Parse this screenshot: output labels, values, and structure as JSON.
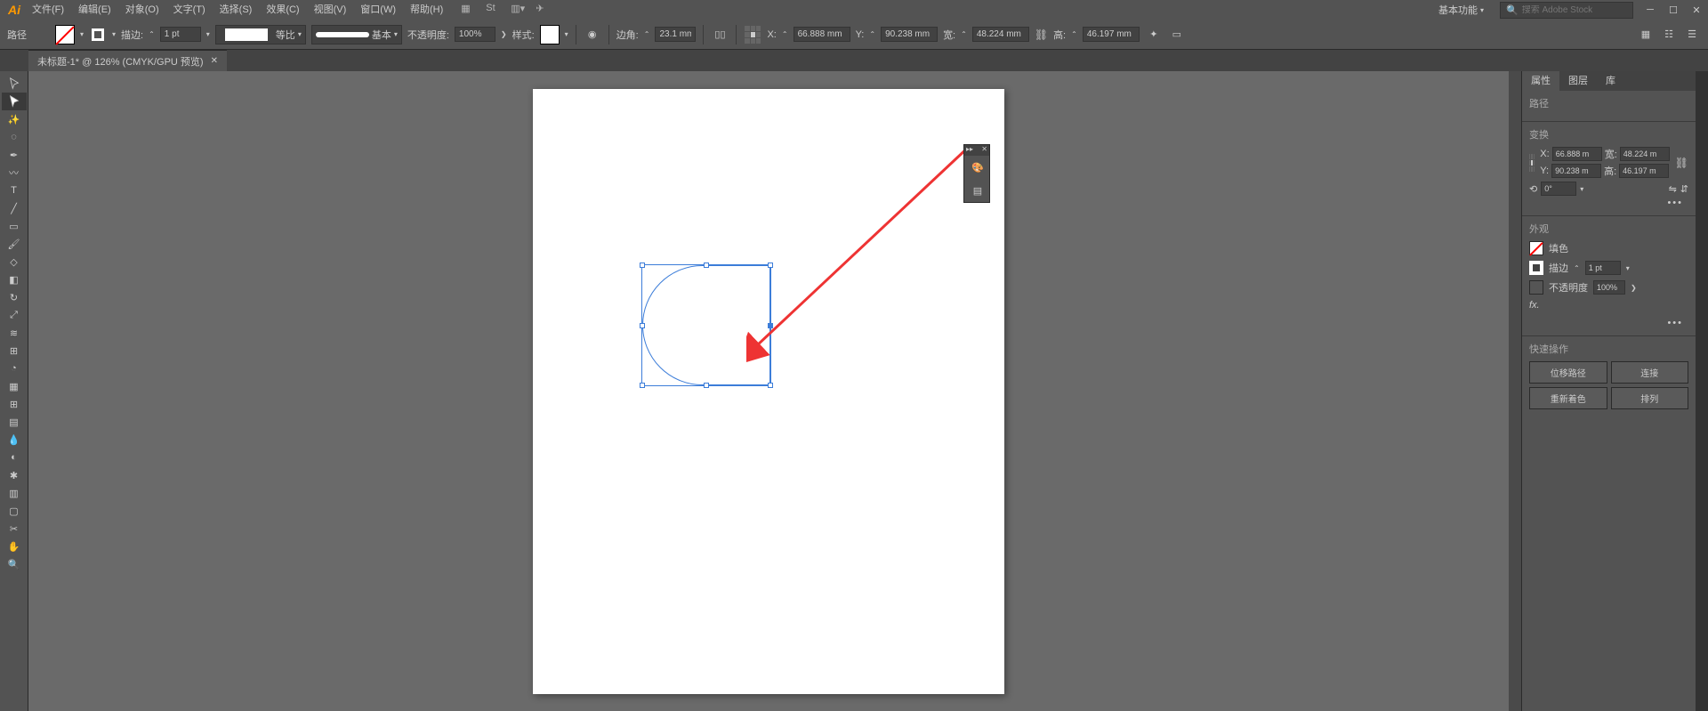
{
  "menu": {
    "file": "文件(F)",
    "edit": "编辑(E)",
    "object": "对象(O)",
    "type": "文字(T)",
    "select": "选择(S)",
    "effect": "效果(C)",
    "view": "视图(V)",
    "window": "窗口(W)",
    "help": "帮助(H)"
  },
  "workspace": "基本功能",
  "search_placeholder": "搜索 Adobe Stock",
  "control": {
    "path_label": "路径",
    "stroke_label": "描边:",
    "stroke_value": "1 pt",
    "equal_label": "等比",
    "basic_label": "基本",
    "opacity_label": "不透明度:",
    "opacity_value": "100%",
    "style_label": "样式:",
    "corner_label": "边角:",
    "corner_value": "23.1 mm",
    "x_label": "X:",
    "x_value": "66.888 mm",
    "y_label": "Y:",
    "y_value": "90.238 mm",
    "w_label": "宽:",
    "w_value": "48.224 mm",
    "h_label": "高:",
    "h_value": "46.197 mm"
  },
  "tab": {
    "title": "未标题-1* @ 126% (CMYK/GPU 预览)"
  },
  "panels": {
    "properties": "属性",
    "layers": "图层",
    "libraries": "库",
    "path_label": "路径",
    "transform_label": "变换",
    "x_label": "X:",
    "x_value": "66.888 m",
    "y_label": "Y:",
    "y_value": "90.238 m",
    "w_label": "宽:",
    "w_value": "48.224 m",
    "h_label": "高:",
    "h_value": "46.197 m",
    "rotate_value": "0°",
    "appearance_label": "外观",
    "fill_label": "填色",
    "stroke_label": "描边",
    "stroke_value": "1 pt",
    "opacity_label": "不透明度",
    "opacity_value": "100%",
    "fx_label": "fx.",
    "quick_actions_label": "快速操作",
    "offset_path": "位移路径",
    "join": "连接",
    "recolor": "重新着色",
    "arrange": "排列"
  }
}
